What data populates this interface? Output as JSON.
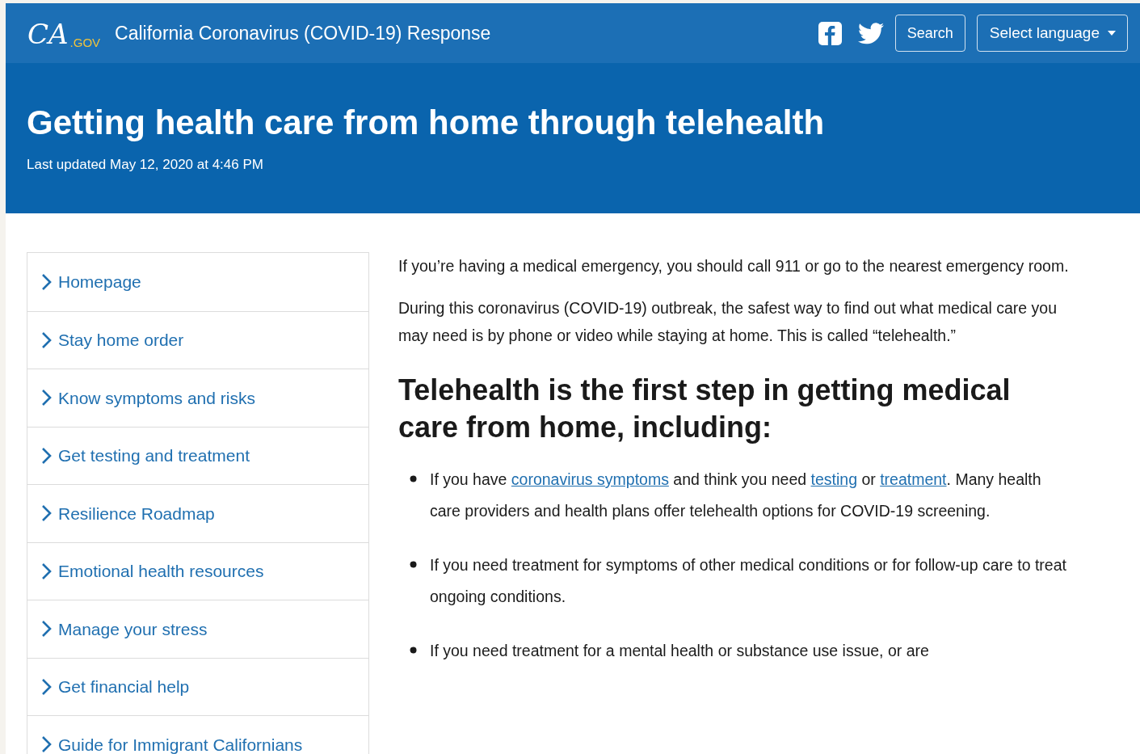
{
  "header": {
    "logo": {
      "script": "CA",
      "suffix": ".GOV"
    },
    "site_title": "California Coronavirus (COVID-19) Response",
    "social": [
      {
        "kind": "facebook"
      },
      {
        "kind": "twitter"
      }
    ],
    "search_button": "Search",
    "language_button": "Select language"
  },
  "hero": {
    "title": "Getting health care from home through telehealth",
    "updated": "Last updated May 12, 2020 at 4:46 PM"
  },
  "sidebar": {
    "items": [
      {
        "label": "Homepage"
      },
      {
        "label": "Stay home order"
      },
      {
        "label": "Know symptoms and risks"
      },
      {
        "label": "Get testing and treatment"
      },
      {
        "label": "Resilience Roadmap"
      },
      {
        "label": "Emotional health resources"
      },
      {
        "label": "Manage your stress"
      },
      {
        "label": "Get financial help"
      },
      {
        "label": "Guide for Immigrant Californians"
      }
    ]
  },
  "content": {
    "paragraphs": [
      "If you’re having a medical emergency, you should call 911 or go to the nearest emergency room.",
      "During this coronavirus (COVID-19) outbreak, the safest way to find out what medical care you may need is by phone or video while staying at home. This is called “telehealth.”"
    ],
    "heading": "Telehealth is the first step in getting medical care from home, including:",
    "bullets": [
      {
        "segments": [
          {
            "kind": "text",
            "text": "If you have "
          },
          {
            "kind": "link",
            "text": "coronavirus symptoms"
          },
          {
            "kind": "text",
            "text": " and think you need "
          },
          {
            "kind": "link",
            "text": "testing"
          },
          {
            "kind": "text",
            "text": " or "
          },
          {
            "kind": "link",
            "text": "treatment"
          },
          {
            "kind": "text",
            "text": ". Many health care providers and health plans offer telehealth options for COVID-19 screening."
          }
        ]
      },
      {
        "segments": [
          {
            "kind": "text",
            "text": "If you need treatment for symptoms of other medical conditions or for follow-up care to treat ongoing conditions."
          }
        ]
      },
      {
        "segments": [
          {
            "kind": "text",
            "text": "If you need treatment for a mental health or substance use issue, or are"
          }
        ]
      }
    ]
  }
}
